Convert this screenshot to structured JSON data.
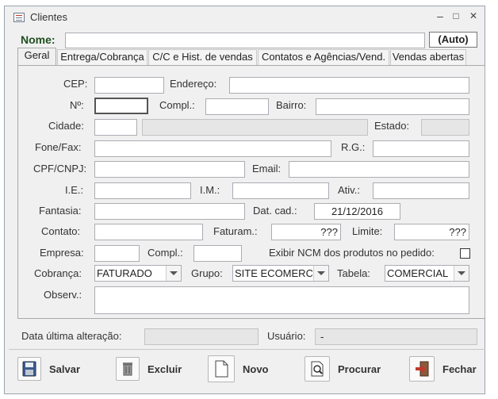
{
  "window": {
    "title": "Clientes",
    "min": "–",
    "max": "□",
    "close": "✕"
  },
  "nome": {
    "label": "Nome:",
    "value": "",
    "auto_button": "(Auto)"
  },
  "tabs": [
    "Geral",
    "Entrega/Cobrança",
    "C/C e Hist. de vendas",
    "Contatos e Agências/Vend.",
    "Vendas abertas"
  ],
  "form": {
    "cep": {
      "label": "CEP:",
      "value": ""
    },
    "endereco": {
      "label": "Endereço:",
      "value": ""
    },
    "numero": {
      "label": "Nº:",
      "value": ""
    },
    "compl": {
      "label": "Compl.:",
      "value": ""
    },
    "bairro": {
      "label": "Bairro:",
      "value": ""
    },
    "cidade": {
      "label": "Cidade:",
      "value": "",
      "name_value": ""
    },
    "estado": {
      "label": "Estado:",
      "value": ""
    },
    "fone": {
      "label": "Fone/Fax:",
      "value": ""
    },
    "rg": {
      "label": "R.G.:",
      "value": ""
    },
    "cpf": {
      "label": "CPF/CNPJ:",
      "value": ""
    },
    "email": {
      "label": "Email:",
      "value": ""
    },
    "ie": {
      "label": "I.E.:",
      "value": ""
    },
    "im": {
      "label": "I.M.:",
      "value": ""
    },
    "ativ": {
      "label": "Ativ.:",
      "value": ""
    },
    "fantasia": {
      "label": "Fantasia:",
      "value": ""
    },
    "datcad": {
      "label": "Dat. cad.:",
      "value": "21/12/2016"
    },
    "contato": {
      "label": "Contato:",
      "value": ""
    },
    "faturam": {
      "label": "Faturam.:",
      "value": "???"
    },
    "limite": {
      "label": "Limite:",
      "value": "???"
    },
    "empresa": {
      "label": "Empresa:",
      "value": ""
    },
    "compl2": {
      "label": "Compl.:",
      "value": ""
    },
    "ncm": {
      "label": "Exibir NCM dos produtos no pedido:",
      "checked": false
    },
    "cobranca": {
      "label": "Cobrança:",
      "value": "FATURADO"
    },
    "grupo": {
      "label": "Grupo:",
      "value": "SITE ECOMERCI"
    },
    "tabela": {
      "label": "Tabela:",
      "value": "COMERCIAL"
    },
    "observ": {
      "label": "Observ.:",
      "value": ""
    }
  },
  "footer": {
    "data_label": "Data última alteração:",
    "data_value": "",
    "usuario_label": "Usuário:",
    "usuario_value": "-"
  },
  "buttons": {
    "salvar": "Salvar",
    "excluir": "Excluir",
    "novo": "Novo",
    "procurar": "Procurar",
    "fechar": "Fechar"
  },
  "colors": {
    "nome_label": "#1f4f1f",
    "accent_red": "#c0392b"
  }
}
